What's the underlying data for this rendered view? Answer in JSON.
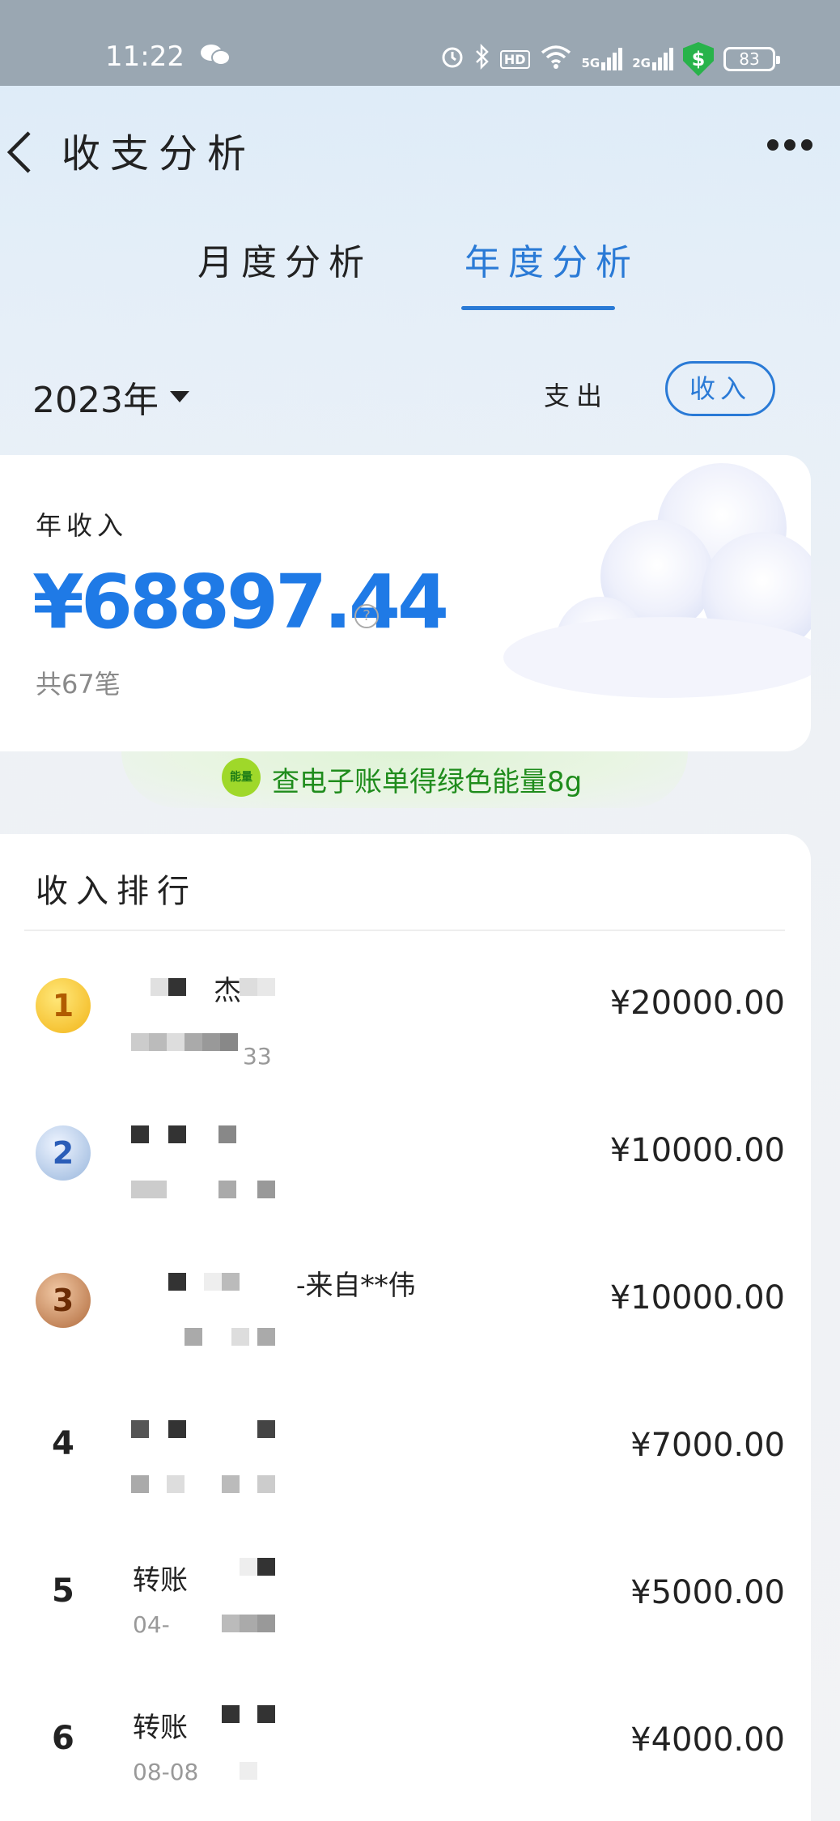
{
  "status_bar": {
    "time": "11:22",
    "battery": "83",
    "hd_label": "HD",
    "net_5g": "5G",
    "net_2g": "2G"
  },
  "header": {
    "title": "收支分析"
  },
  "tabs": {
    "month": "月度分析",
    "year": "年度分析",
    "active": "year"
  },
  "filter": {
    "year": "2023年",
    "expense_label": "支出",
    "income_label": "收入",
    "active": "income"
  },
  "summary": {
    "label": "年收入",
    "amount": "¥68897.44",
    "count": "共67笔",
    "help": "?"
  },
  "energy_banner": {
    "badge": "能量",
    "text": "查电子账单得绿色能量8g"
  },
  "ranking": {
    "title": "收入排行",
    "items": [
      {
        "rank": "1",
        "title": "杰",
        "sub": "33",
        "amount": "¥20000.00"
      },
      {
        "rank": "2",
        "title": "",
        "sub": "",
        "amount": "¥10000.00"
      },
      {
        "rank": "3",
        "title": "-来自**伟",
        "sub": "",
        "amount": "¥10000.00"
      },
      {
        "rank": "4",
        "title": "",
        "sub": "",
        "amount": "¥7000.00"
      },
      {
        "rank": "5",
        "title": "转账",
        "sub": "04-",
        "amount": "¥5000.00"
      },
      {
        "rank": "6",
        "title": "转账",
        "sub": "08-08",
        "amount": "¥4000.00"
      }
    ]
  },
  "colors": {
    "accent": "#2a7ad6",
    "amount_blue": "#1f7ae6",
    "energy_green": "#1f8c1c"
  }
}
